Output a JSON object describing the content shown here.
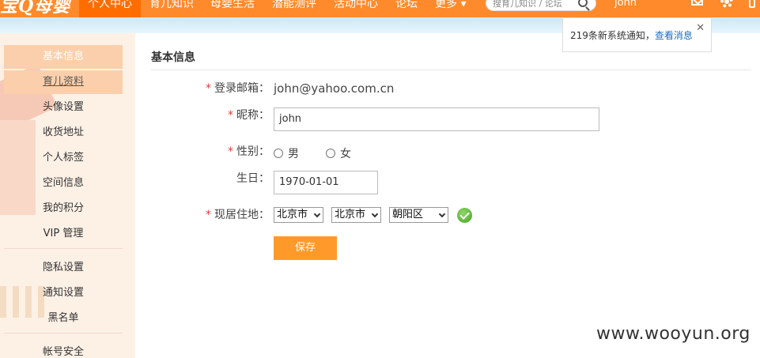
{
  "nav": {
    "logo": "宝Q母婴",
    "items": [
      "个人中心",
      "育儿知识",
      "母婴生活",
      "潜能测评",
      "活动中心",
      "论坛",
      "更多"
    ],
    "search_placeholder": "搜育儿知识 / 论坛",
    "username": "john",
    "colors": {
      "bar": "#ff8a2b",
      "active": "#ff6d00"
    }
  },
  "sidebar": {
    "items": [
      "基本信息",
      "育儿资料",
      "头像设置",
      "收货地址",
      "个人标签",
      "空间信息",
      "我的积分",
      "VIP 管理",
      "隐私设置",
      "通知设置",
      "黑名单",
      "帐号安全"
    ]
  },
  "main": {
    "title": "基本信息",
    "email_label": "登录邮箱：",
    "email_value": "john@yahoo.com.cn",
    "nickname_label": "昵称：",
    "nickname_value": "john",
    "gender_label": "性别：",
    "gender_male": "男",
    "gender_female": "女",
    "birthday_label": "生日：",
    "birthday_value": "1970-01-01",
    "location_label": "现居住地：",
    "province": "北京市",
    "city": "北京市",
    "district": "朝阳区",
    "save_label": "保存"
  },
  "notice": {
    "text": "219条新系统通知，",
    "link": "查看消息",
    "close": "✕"
  },
  "watermark": "www.wooyun.org"
}
